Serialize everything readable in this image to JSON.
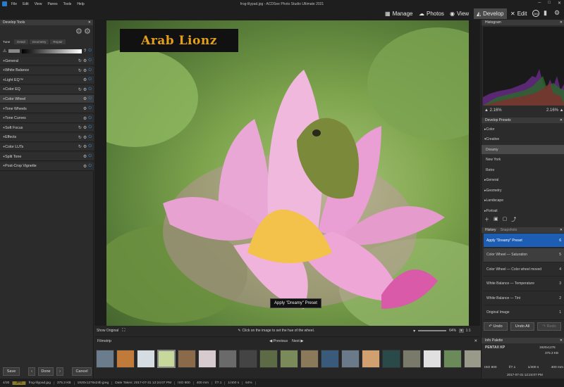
{
  "app": {
    "window_title": "frog-lilypad.jpg - ACDSee Photo Studio Ultimate 2021",
    "menu": [
      "File",
      "Edit",
      "View",
      "Panes",
      "Tools",
      "Help"
    ]
  },
  "modes": [
    "Manage",
    "Photos",
    "View",
    "Develop",
    "Edit"
  ],
  "left_panel": {
    "title": "Develop Tools",
    "tabs": [
      "Tune",
      "Detail",
      "Geometry",
      "Repair"
    ],
    "tools": [
      "General",
      "White Balance",
      "Light EQ™",
      "Color EQ",
      "Color Wheel",
      "Tone Wheels",
      "Tone Curves",
      "Soft Focus",
      "Effects",
      "Color LUTs",
      "Split Tone",
      "Post-Crop Vignette"
    ],
    "buttons": {
      "save": "Save",
      "done": "Done",
      "cancel": "Cancel"
    }
  },
  "viewer": {
    "watermark": "Arab Lionz",
    "tooltip": "Apply \"Dreamy\" Preset",
    "show_original": "Show Original",
    "hint": "Click on the image to set the hue of the wheel.",
    "zoom": "64%",
    "ratio": "1:1"
  },
  "filmstrip": {
    "title": "Filmstrip",
    "prev": "Previous",
    "next": "Next",
    "thumb_colors": [
      "#6b7d8c",
      "#c07a3a",
      "#d6dde2",
      "#c7d99a",
      "#8a6a4a",
      "#d8cbd0",
      "#6a6a6a",
      "#444444",
      "#5c6a46",
      "#7a8a5a",
      "#8a7a5a",
      "#3a5a7a",
      "#6a7a8a",
      "#d0a070",
      "#2a4a4a",
      "#7a7a6a",
      "#e0e0e0",
      "#6a8a5a",
      "#9a9a8a",
      "#8a6a5a"
    ]
  },
  "right_panel": {
    "histogram_title": "Histogram",
    "hist_left": "2.16%",
    "hist_right": "2.16%",
    "presets_title": "Develop Presets",
    "presets": [
      {
        "label": "Color",
        "type": "group"
      },
      {
        "label": "Creative",
        "type": "group"
      },
      {
        "label": "Dreamy",
        "type": "item",
        "selected": true
      },
      {
        "label": "New York",
        "type": "item"
      },
      {
        "label": "Retro",
        "type": "item"
      },
      {
        "label": "General",
        "type": "group"
      },
      {
        "label": "Geometry",
        "type": "group"
      },
      {
        "label": "Landscape",
        "type": "group"
      },
      {
        "label": "Portrait",
        "type": "group"
      }
    ],
    "history_tabs": [
      "History",
      "Snapshots"
    ],
    "history": [
      {
        "label": "Apply \"Dreamy\" Preset",
        "n": "6"
      },
      {
        "label": "Color Wheel — Saturation",
        "n": "5"
      },
      {
        "label": "Color Wheel — Color wheel moved",
        "n": "4"
      },
      {
        "label": "White Balance — Temperature",
        "n": "3"
      },
      {
        "label": "White Balance — Tint",
        "n": "2"
      },
      {
        "label": "Original Image",
        "n": "1"
      }
    ],
    "undo": "Undo",
    "undo_all": "Undo All",
    "redo": "Redo",
    "info_title": "Info Palette",
    "info": {
      "camera": "PENTAX KP",
      "dims": "1920x1276",
      "size": "375.3 KB",
      "iso": "ISO 800",
      "aperture": "f/7.1",
      "shutter": "1/400 s",
      "focal": "400 mm",
      "date": "2017-07-31 12:24:07 PM"
    }
  },
  "statusbar": [
    "4/30",
    "JPG",
    "frog-lilypad.jpg",
    "375.3 KB",
    "1920x1276x24b jpeg",
    "Date Taken: 2017-07-31 12:24:07 PM",
    "ISO 800",
    "400 mm",
    "f/7.1",
    "1/400 s",
    "64%"
  ]
}
